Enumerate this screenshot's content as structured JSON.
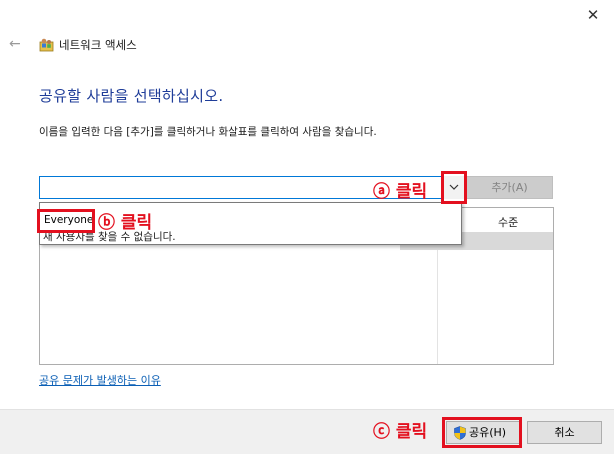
{
  "window": {
    "title": "네트워크 액세스",
    "close_glyph": "✕",
    "back_glyph": "←"
  },
  "main": {
    "heading": "공유할 사람을 선택하십시오.",
    "instruction": "이름을 입력한 다음 [추가]를 클릭하거나 화살표를 클릭하여 사람을 찾습니다.",
    "name_input": {
      "value": "",
      "placeholder": ""
    },
    "add_button": "추가(A)",
    "list": {
      "column_header": "수준"
    },
    "dropdown": {
      "items": [
        "Everyone"
      ],
      "note": "새 사용자를 찾을 수 없습니다."
    },
    "help_link": "공유 문제가 발생하는 이유"
  },
  "footer": {
    "share_button": "공유(H)",
    "cancel_button": "취소"
  },
  "annotations": {
    "a": "ⓐ 클릭",
    "b": "ⓑ 클릭",
    "c": "ⓒ 클릭",
    "color": "#e3101f"
  },
  "colors": {
    "heading": "#1f3d99",
    "accent_border": "#0078d7",
    "link": "#0b5fb5"
  }
}
